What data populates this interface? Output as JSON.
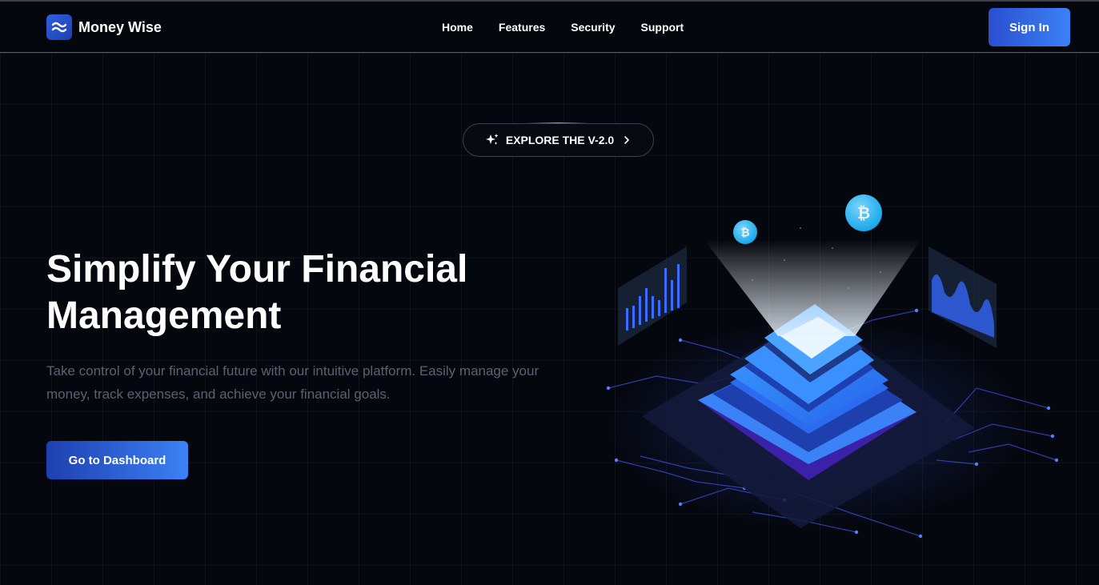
{
  "brand": {
    "name": "Money Wise",
    "logo_icon": "waves-icon"
  },
  "nav": {
    "items": [
      {
        "label": "Home"
      },
      {
        "label": "Features"
      },
      {
        "label": "Security"
      },
      {
        "label": "Support"
      }
    ]
  },
  "header": {
    "signin_label": "Sign In"
  },
  "hero": {
    "badge_label": "EXPLORE THE V-2.0",
    "badge_icon": "sparkles-icon",
    "title": "Simplify Your Financial Management",
    "subtitle": "Take control of your financial future with our intuitive platform. Easily manage your money, track expenses, and achieve your financial goals.",
    "cta_label": "Go to Dashboard"
  },
  "colors": {
    "background": "#05070f",
    "accent": "#3b82f6",
    "accent_dark": "#1e3fb0",
    "muted_text": "#5b6170"
  }
}
